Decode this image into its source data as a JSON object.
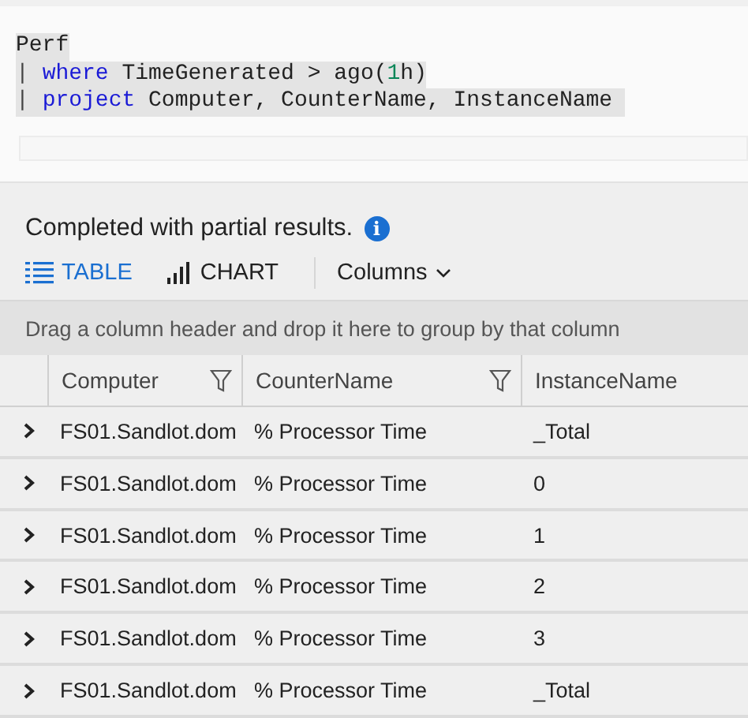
{
  "query": {
    "lines": [
      {
        "tokens": [
          {
            "text": "Perf",
            "kind": "plain"
          }
        ]
      },
      {
        "tokens": [
          {
            "text": "| ",
            "kind": "pipe"
          },
          {
            "text": "where",
            "kind": "keyword"
          },
          {
            "text": " TimeGenerated > ago(",
            "kind": "plain"
          },
          {
            "text": "1",
            "kind": "number"
          },
          {
            "text": "h)",
            "kind": "plain"
          }
        ]
      },
      {
        "tokens": [
          {
            "text": "| ",
            "kind": "pipe"
          },
          {
            "text": "project",
            "kind": "keyword"
          },
          {
            "text": " Computer, CounterName, InstanceName ",
            "kind": "plain"
          }
        ]
      }
    ]
  },
  "status": {
    "message": "Completed with partial results.",
    "info_icon": "i"
  },
  "view_tabs": [
    {
      "label": "TABLE",
      "kind": "table",
      "selected": true
    },
    {
      "label": "CHART",
      "kind": "chart",
      "selected": false
    }
  ],
  "columns_menu": {
    "label": "Columns"
  },
  "group_bar": {
    "text": "Drag a column header and drop it here to group by that column"
  },
  "table": {
    "columns": [
      {
        "label": "Computer",
        "filter": true
      },
      {
        "label": "CounterName",
        "filter": true
      },
      {
        "label": "InstanceName",
        "filter": false
      }
    ],
    "rows": [
      {
        "cells": [
          "FS01.Sandlot.dom",
          "% Processor Time",
          "_Total"
        ]
      },
      {
        "cells": [
          "FS01.Sandlot.dom",
          "% Processor Time",
          "0"
        ]
      },
      {
        "cells": [
          "FS01.Sandlot.dom",
          "% Processor Time",
          "1"
        ]
      },
      {
        "cells": [
          "FS01.Sandlot.dom",
          "% Processor Time",
          "2"
        ]
      },
      {
        "cells": [
          "FS01.Sandlot.dom",
          "% Processor Time",
          "3"
        ]
      },
      {
        "cells": [
          "FS01.Sandlot.dom",
          "% Processor Time",
          "_Total"
        ]
      }
    ]
  }
}
